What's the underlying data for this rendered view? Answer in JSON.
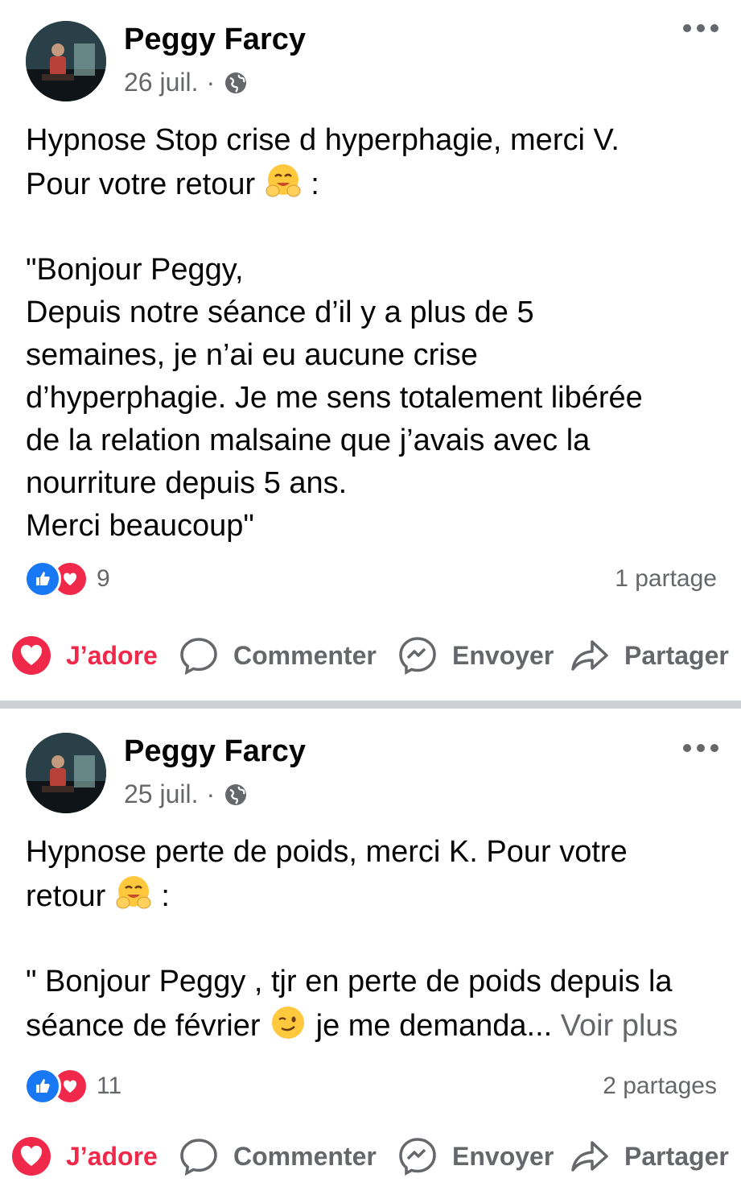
{
  "posts": [
    {
      "author": "Peggy Farcy",
      "date": "26 juil.",
      "separator": "·",
      "privacy_icon": "globe-icon",
      "text_lines_1": "Hypnose Stop crise d hyperphagie, merci V.\nPour votre retour",
      "text_emoji_1": "hugging-face-emoji",
      "text_after_emoji_1": " :",
      "text_block_2": "\"Bonjour Peggy,\nDepuis notre séance d’il y a plus de 5\nsemaines, je n’ai eu aucune crise\nd’hyperphagie. Je me sens totalement libérée\nde la relation malsaine que j’avais avec la\nnourriture depuis 5 ans.\nMerci beaucoup\"",
      "reaction_icons": [
        "like-icon",
        "love-icon"
      ],
      "reaction_count": "9",
      "shares": "1 partage",
      "actions": {
        "love": "J’adore",
        "comment": "Commenter",
        "send": "Envoyer",
        "share": "Partager"
      }
    },
    {
      "author": "Peggy Farcy",
      "date": "25 juil.",
      "separator": "·",
      "privacy_icon": "globe-icon",
      "text_line_1": "Hypnose perte de poids, merci K. Pour votre",
      "text_line_2_before": "retour ",
      "text_emoji_1": "hugging-face-emoji",
      "text_line_2_after": " :",
      "text_line_3": "\" Bonjour Peggy  , tjr en perte de poids depuis la",
      "text_line_4_before": "séance de février ",
      "text_emoji_2": "winking-face-emoji",
      "text_line_4_after": " je me demanda... ",
      "see_more": "Voir plus",
      "reaction_icons": [
        "like-icon",
        "love-icon"
      ],
      "reaction_count": "11",
      "shares": "2 partages",
      "actions": {
        "love": "J’adore",
        "comment": "Commenter",
        "send": "Envoyer",
        "share": "Partager"
      }
    }
  ],
  "colors": {
    "love": "#f0284a",
    "like": "#1877f2",
    "secondary_text": "#65676b",
    "divider": "#cdd0d4"
  }
}
